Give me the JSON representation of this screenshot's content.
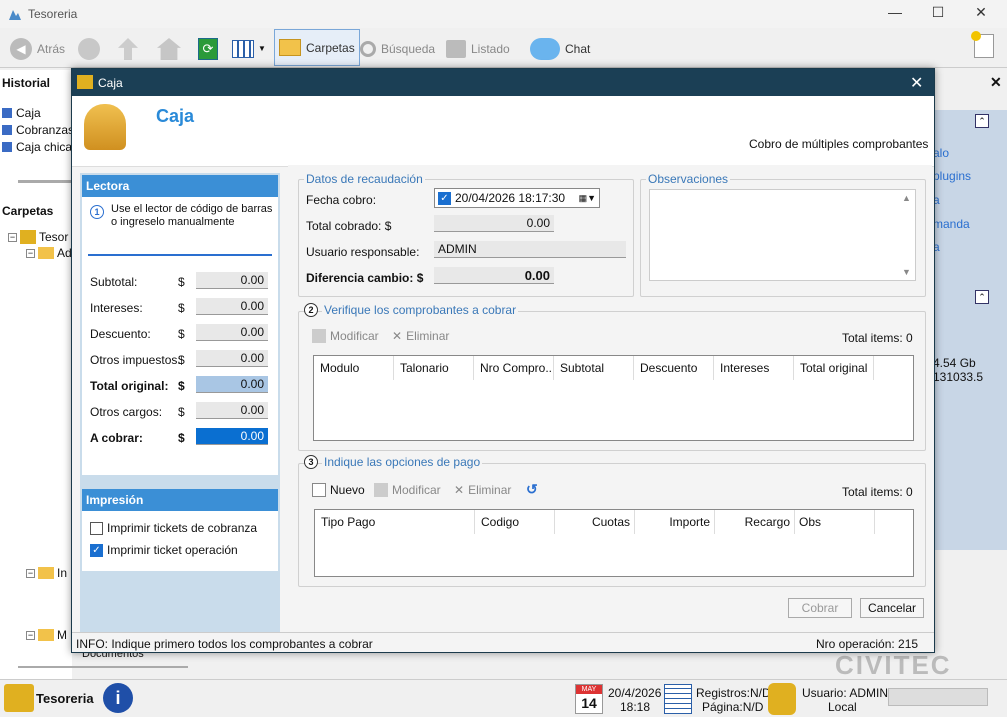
{
  "window": {
    "title": "Tesoreria",
    "min": "—",
    "max": "☐",
    "close": "✕"
  },
  "toolbar": {
    "back": "Atrás",
    "folders": "Carpetas",
    "search": "Búsqueda",
    "list": "Listado",
    "chat": "Chat"
  },
  "sidebar": {
    "history_title": "Historial",
    "history_items": [
      "Caja",
      "Cobranzas",
      "Caja chica"
    ],
    "folders_title": "Carpetas",
    "tree_root": "Tesor",
    "tree_items": [
      "Ad",
      "In",
      "M"
    ],
    "last_item": "Documentos"
  },
  "right_panel": {
    "items": [
      "alo",
      "plugins",
      "a",
      "manda",
      "a"
    ],
    "disk": "4.54 Gb",
    "num": "131033.5",
    "brand": "CIVITEC"
  },
  "dialog": {
    "title": "Caja",
    "heading": "Caja",
    "subtitle": "Cobro de múltiples comprobantes",
    "lectora": {
      "title": "Lectora",
      "step": "1",
      "instructions": "Use el lector de código de barras o ingreselo manualmente",
      "input_value": "",
      "rows": [
        {
          "label": "Subtotal:",
          "cur": "$",
          "value": "0.00",
          "bold": false,
          "style": ""
        },
        {
          "label": "Intereses:",
          "cur": "$",
          "value": "0.00",
          "bold": false,
          "style": ""
        },
        {
          "label": "Descuento:",
          "cur": "$",
          "value": "0.00",
          "bold": false,
          "style": ""
        },
        {
          "label": "Otros impuestos:",
          "cur": "$",
          "value": "0.00",
          "bold": false,
          "style": ""
        },
        {
          "label": "Total original:",
          "cur": "$",
          "value": "0.00",
          "bold": true,
          "style": "hl"
        },
        {
          "label": "Otros cargos:",
          "cur": "$",
          "value": "0.00",
          "bold": false,
          "style": ""
        },
        {
          "label": "A cobrar:",
          "cur": "$",
          "value": "0.00",
          "bold": true,
          "style": "sel"
        }
      ]
    },
    "impresion": {
      "title": "Impresión",
      "opt1": "Imprimir tickets de cobranza",
      "opt1_checked": false,
      "opt2": "Imprimir ticket operación",
      "opt2_checked": true
    },
    "recaudacion": {
      "title": "Datos de recaudación",
      "fecha_label": "Fecha cobro:",
      "fecha_value": "20/04/2026 18:17:30",
      "total_label": "Total cobrado: $",
      "total_value": "0.00",
      "usuario_label": "Usuario responsable:",
      "usuario_value": "ADMIN",
      "dif_label": "Diferencia cambio: $",
      "dif_value": "0.00"
    },
    "observaciones": {
      "title": "Observaciones",
      "value": ""
    },
    "comprobantes": {
      "step": "2",
      "title": "Verifique los comprobantes a cobrar",
      "modificar": "Modificar",
      "eliminar": "Eliminar",
      "total_items": "Total items: 0",
      "columns": [
        "Modulo",
        "Talonario",
        "Nro Compro...",
        "Subtotal",
        "Descuento",
        "Intereses",
        "Total original"
      ]
    },
    "pago": {
      "step": "3",
      "title": "Indique las opciones de pago",
      "nuevo": "Nuevo",
      "modificar": "Modificar",
      "eliminar": "Eliminar",
      "total_items": "Total items: 0",
      "columns": [
        "Tipo Pago",
        "Codigo",
        "Cuotas",
        "Importe",
        "Recargo",
        "Obs"
      ]
    },
    "buttons": {
      "cobrar": "Cobrar",
      "cancelar": "Cancelar"
    },
    "status_info": "INFO: Indique primero todos los comprobantes a cobrar",
    "status_op": "Nro operación: 215"
  },
  "statusbar": {
    "app": "Tesoreria",
    "cal_month": "MAY",
    "cal_day": "14",
    "date": "20/4/2026",
    "time": "18:18",
    "registros": "Registros:N/D",
    "pagina": "Página:N/D",
    "usuario": "Usuario: ADMIN",
    "local": "Local"
  }
}
